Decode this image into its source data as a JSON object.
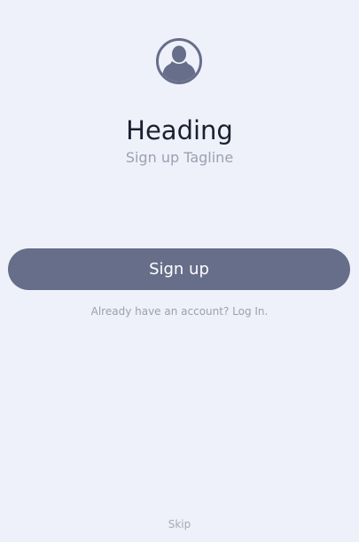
{
  "header": {
    "avatar_icon": "user-avatar-icon",
    "title": "Heading",
    "tagline": "Sign up Tagline"
  },
  "actions": {
    "signup_label": "Sign up",
    "login_prompt": "Already have an account? Log In.",
    "skip_label": "Skip"
  },
  "colors": {
    "background": "#EEF1FA",
    "primary": "#676E89",
    "heading_text": "#1C1F2E",
    "muted_text": "#9CA0B0"
  }
}
